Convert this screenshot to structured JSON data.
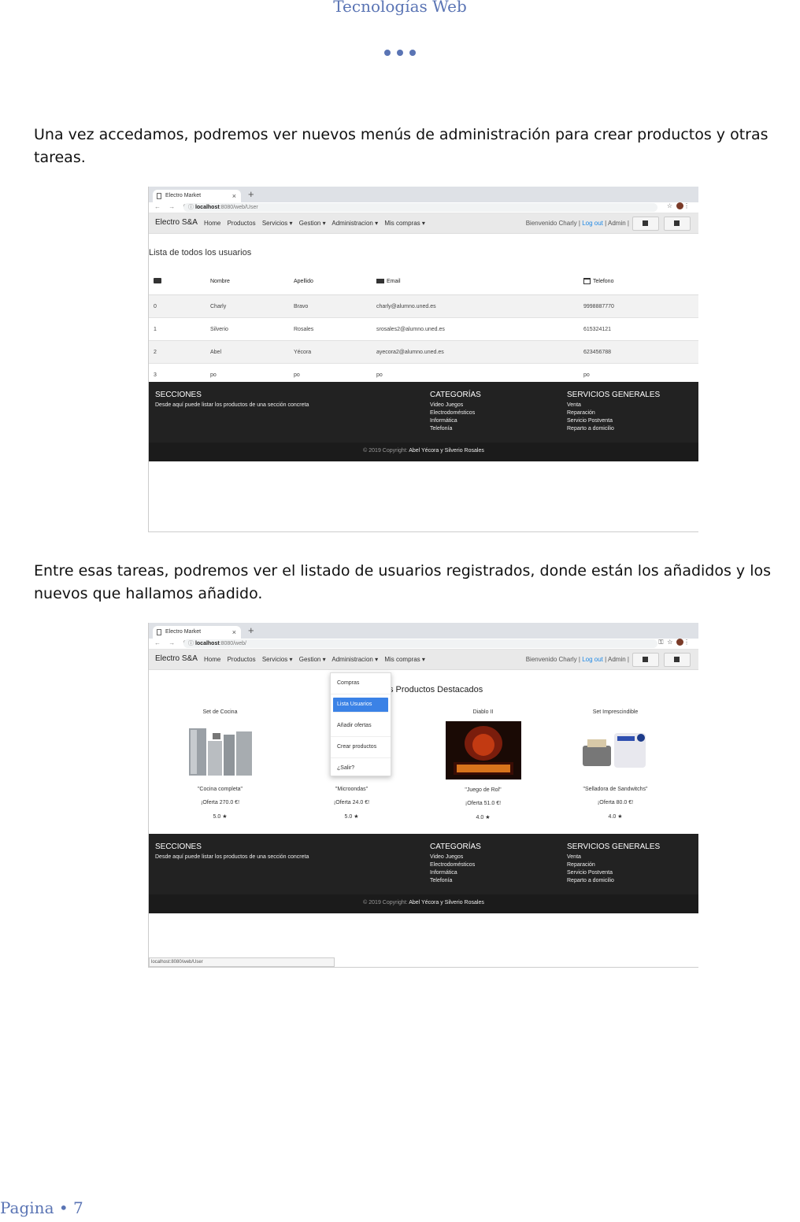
{
  "doc": {
    "header": "Tecnologías Web",
    "para1": "Una vez accedamos, podremos ver nuevos menús de administración para crear productos y otras tareas.",
    "para2": "Entre esas tareas, podremos ver el listado de usuarios registrados, donde están los añadidos y los nuevos que hallamos añadido.",
    "page_footer": "Pagina • 7"
  },
  "browser": {
    "tab_title": "Electro Market",
    "tab_close": "×",
    "new_tab": "+",
    "nav": "← → C",
    "url1_host": "localhost",
    "url1_path": ":8080/web/User",
    "url2_host": "localhost",
    "url2_path": ":8080/web/",
    "status_url": "localhost:8080/web/User"
  },
  "navbar": {
    "brand": "Electro S&A",
    "links": [
      "Home",
      "Productos",
      "Servicios ▾",
      "Gestion ▾",
      "Administracion ▾",
      "Mis compras ▾"
    ],
    "welcome": "Bienvenido Charly",
    "sep": "|",
    "logout": "Log out",
    "admin": "Admin"
  },
  "users": {
    "title": "Lista de todos los usuarios",
    "headers": [
      "",
      "Nombre",
      "Apellido",
      "Email",
      "Telefono"
    ],
    "rows": [
      [
        "0",
        "Charly",
        "Bravo",
        "charly@alumno.uned.es",
        "9998887770"
      ],
      [
        "1",
        "Silverio",
        "Rosales",
        "srosales2@alumno.uned.es",
        "615324121"
      ],
      [
        "2",
        "Abel",
        "Yécora",
        "ayecora2@alumno.uned.es",
        "623456788"
      ],
      [
        "3",
        "po",
        "po",
        "po",
        "po"
      ]
    ]
  },
  "site_footer": {
    "secciones": "SECCIONES",
    "secciones_text": "Desde aquí puede listar los productos de una sección concreta",
    "categorias": "CATEGORÍAS",
    "categorias_items": [
      "Video Juegos",
      "Electrodomésticos",
      "Informática",
      "Telefonía"
    ],
    "servicios": "SERVICIOS GENERALES",
    "servicios_items": [
      "Venta",
      "Reparación",
      "Servicio Postventa",
      "Reparto a domicilio"
    ],
    "copyright_prefix": "© 2019 Copyright:",
    "copyright_names": "Abel Yécora y Silverio Rosales"
  },
  "products": {
    "title": "s Productos Destacados",
    "items": [
      {
        "name": "Set de Cocina",
        "desc": "\"Cocina completa\"",
        "offer": "¡Oferta 270.0 €!",
        "rating": "5.0 ★"
      },
      {
        "name": "",
        "desc": "\"Microondas\"",
        "offer": "¡Oferta 24.0 €!",
        "rating": "5.0 ★"
      },
      {
        "name": "Diablo II",
        "desc": "\"Juego de Rol\"",
        "offer": "¡Oferta 51.0 €!",
        "rating": "4.0 ★"
      },
      {
        "name": "Set Imprescindible",
        "desc": "\"Selladora de Sandwitchs\"",
        "offer": "¡Oferta 80.0 €!",
        "rating": "4.0 ★"
      }
    ]
  },
  "dropdown": [
    "Compras",
    "Lista Usuarios",
    "Añadir ofertas",
    "Crear productos",
    "¿Salir?"
  ],
  "colors": {
    "accent": "#5a74b4",
    "footer_bg": "#222222",
    "link": "#1e88e5",
    "active": "#3b82e6"
  }
}
